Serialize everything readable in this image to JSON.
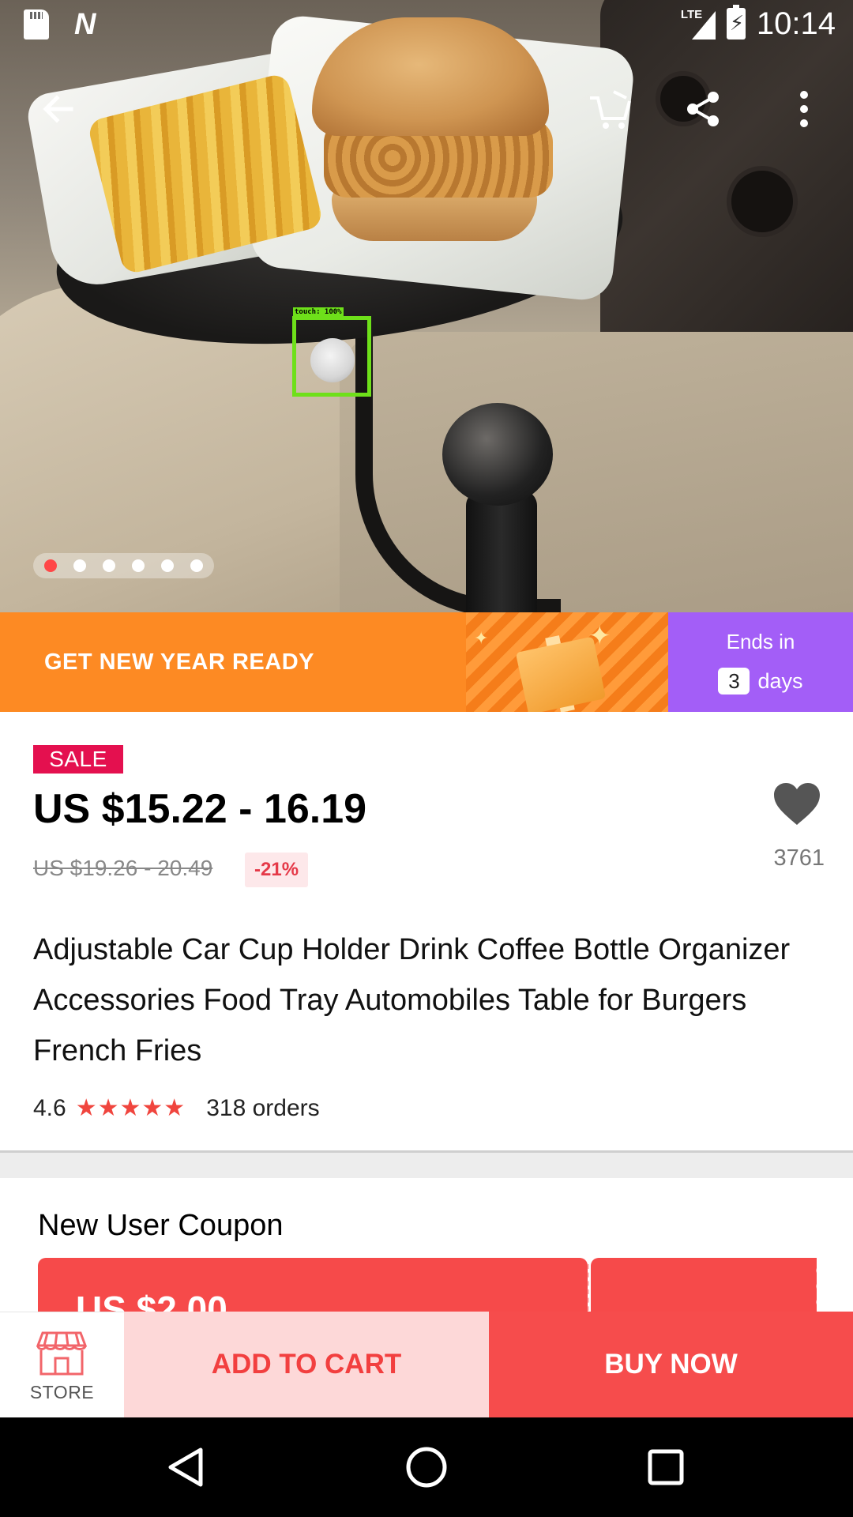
{
  "status_bar": {
    "time": "10:14",
    "network": "LTE",
    "icons": [
      "sd-card-icon",
      "n-notification-icon",
      "lte-signal-icon",
      "battery-charging-icon"
    ]
  },
  "top_bar": {
    "icons": [
      "back-arrow-icon",
      "cart-icon",
      "share-icon",
      "more-vert-icon"
    ]
  },
  "gallery": {
    "image_count": 6,
    "active_index": 0,
    "touch_overlay": "touch: 100%"
  },
  "promo": {
    "text": "GET NEW YEAR READY",
    "ends_label": "Ends in",
    "days_number": "3",
    "days_label": "days",
    "colors": {
      "left": "#fd8a23",
      "right": "#a35ef7"
    }
  },
  "product": {
    "sale_badge": "SALE",
    "price": "US $15.22 - 16.19",
    "original_price": "US $19.26 - 20.49",
    "discount": "-21%",
    "wishlist_count": "3761",
    "title": "Adjustable Car Cup Holder Drink Coffee Bottle Organizer Accessories Food Tray Automobiles Table for Burgers French Fries",
    "rating": "4.6",
    "stars": 4.6,
    "orders": "318 orders"
  },
  "coupon": {
    "title": "New User Coupon",
    "amount": "US $2.00"
  },
  "actions": {
    "store_label": "STORE",
    "add_to_cart": "ADD TO CART",
    "buy_now": "BUY NOW",
    "colors": {
      "add_to_cart_bg": "#fdd8d8",
      "buy_now_bg": "#f64c4c"
    }
  },
  "nav_bar": {
    "icons": [
      "nav-back-icon",
      "nav-home-icon",
      "nav-recents-icon"
    ]
  }
}
